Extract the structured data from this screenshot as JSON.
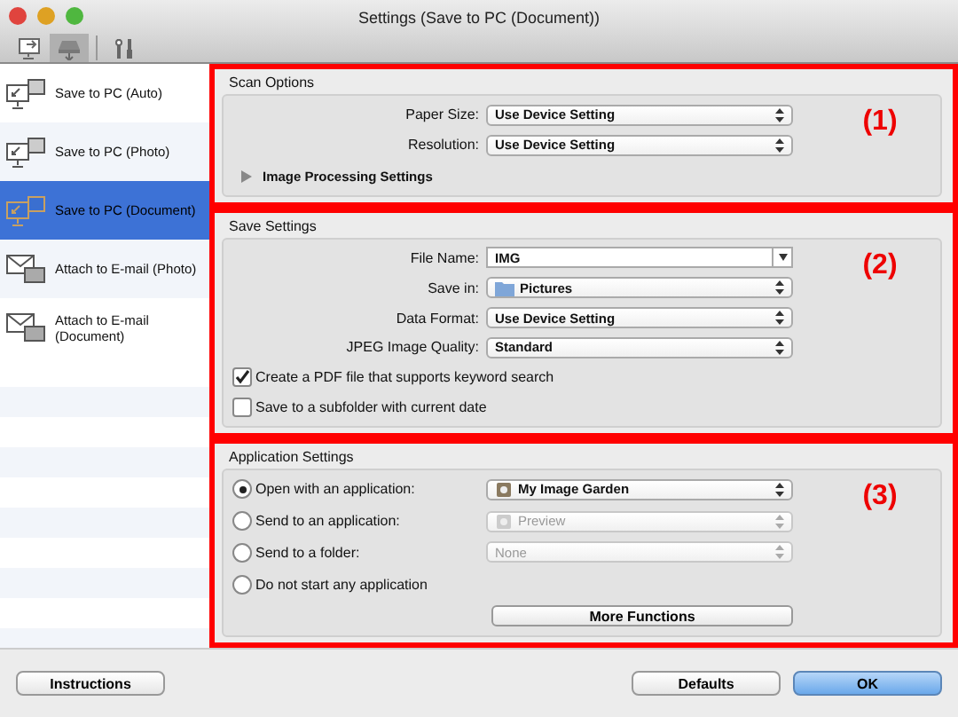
{
  "window": {
    "title": "Settings (Save to PC (Document))"
  },
  "toolbar": [
    {
      "kind": "scan-to-pc",
      "selected": false
    },
    {
      "kind": "scanner",
      "selected": true
    },
    {
      "kind": "tools",
      "selected": false
    }
  ],
  "sidebar": {
    "items": [
      {
        "label": "Save to PC (Auto)",
        "kind": "pc",
        "selected": false
      },
      {
        "label": "Save to PC (Photo)",
        "kind": "pc",
        "selected": false
      },
      {
        "label": "Save to PC (Document)",
        "kind": "pc",
        "selected": true
      },
      {
        "label": "Attach to E-mail (Photo)",
        "kind": "email",
        "selected": false
      },
      {
        "label": "Attach to E-mail (Document)",
        "kind": "email",
        "selected": false
      }
    ]
  },
  "sections": [
    {
      "title": "Scan Options",
      "callout": "(1)",
      "rows": [
        {
          "kind": "select",
          "label": "Paper Size:",
          "value": "Use Device Setting"
        },
        {
          "kind": "select",
          "label": "Resolution:",
          "value": "Use Device Setting"
        },
        {
          "kind": "disclosure",
          "label": "Image Processing Settings",
          "expanded": false
        }
      ]
    },
    {
      "title": "Save Settings",
      "callout": "(2)",
      "rows": [
        {
          "kind": "combo",
          "label": "File Name:",
          "value": "IMG"
        },
        {
          "kind": "select",
          "label": "Save in:",
          "value": "Pictures"
        },
        {
          "kind": "select",
          "label": "Data Format:",
          "value": "Use Device Setting"
        },
        {
          "kind": "select",
          "label": "JPEG Image Quality:",
          "value": "Standard"
        },
        {
          "kind": "checkbox",
          "label": "Create a PDF file that supports keyword search",
          "checked": true
        },
        {
          "kind": "checkbox",
          "label": "Save to a subfolder with current date",
          "checked": false
        }
      ]
    },
    {
      "title": "Application Settings",
      "callout": "(3)",
      "rows": [
        {
          "kind": "radio",
          "label": "Open with an application:",
          "selected": true,
          "value": "My Image Garden",
          "disabled": false
        },
        {
          "kind": "radio",
          "label": "Send to an application:",
          "selected": false,
          "value": "Preview",
          "disabled": true
        },
        {
          "kind": "radio",
          "label": "Send to a folder:",
          "selected": false,
          "value": "None",
          "disabled": true
        },
        {
          "kind": "radio",
          "label": "Do not start any application",
          "selected": false
        },
        {
          "kind": "button",
          "label": "More Functions"
        }
      ]
    }
  ],
  "footer": {
    "left_button": "Instructions",
    "right_buttons": [
      {
        "label": "Defaults",
        "default": false
      },
      {
        "label": "OK",
        "default": true
      }
    ]
  }
}
